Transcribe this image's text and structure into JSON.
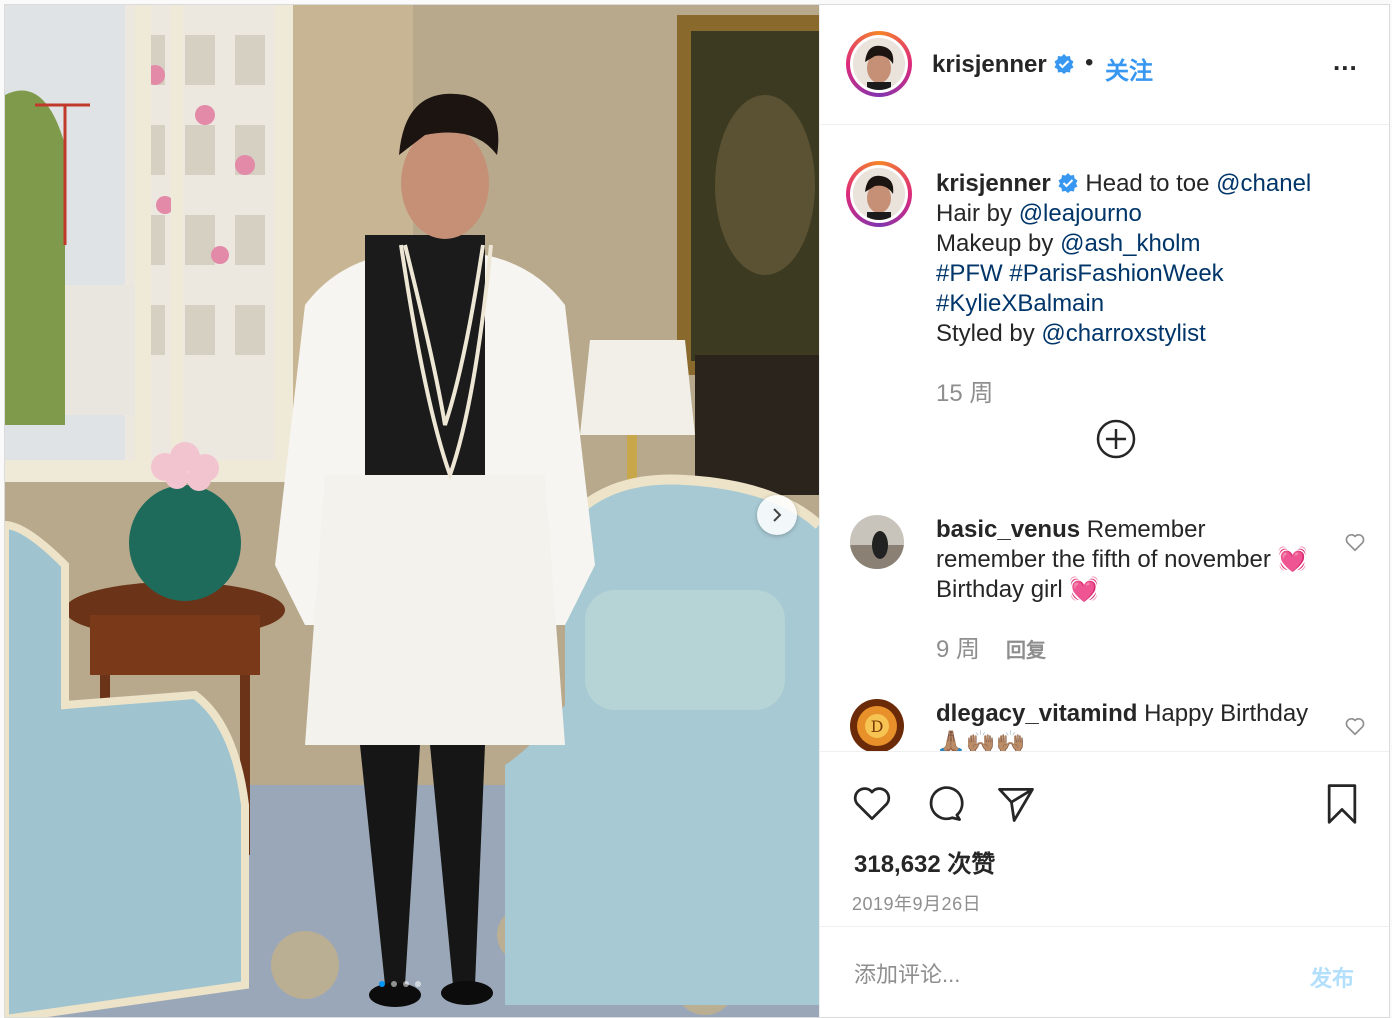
{
  "header": {
    "username": "krisjenner",
    "separator": "•",
    "follow_label": "关注",
    "more_label": "..."
  },
  "caption": {
    "username": "krisjenner",
    "lines": [
      [
        {
          "t": "Head to toe "
        },
        {
          "t": "@chanel",
          "tag": true
        }
      ],
      [
        {
          "t": "Hair by "
        },
        {
          "t": "@leajourno",
          "tag": true
        }
      ],
      [
        {
          "t": "Makeup by "
        },
        {
          "t": "@ash_kholm",
          "tag": true
        }
      ],
      [
        {
          "t": "#PFW",
          "tag": true
        },
        {
          "t": " "
        },
        {
          "t": "#ParisFashionWeek",
          "tag": true
        }
      ],
      [
        {
          "t": "#KylieXBalmain",
          "tag": true
        }
      ],
      [
        {
          "t": "Styled by "
        },
        {
          "t": "@charroxstylist",
          "tag": true
        }
      ]
    ],
    "time": "15 周"
  },
  "comments": [
    {
      "username": "basic_venus",
      "text_1": " Remember remember the fifth of november ",
      "emoji_1": "💓",
      "text_2": " Birthday girl ",
      "emoji_2": "💓",
      "time": "9 周",
      "reply_label": "回复"
    },
    {
      "username": "dlegacy_vitamind",
      "text_1": " Happy Birthday ",
      "emoji_1": "🙏🏽🙌🏽🙌🏽"
    }
  ],
  "stats": {
    "likes": "318,632 次赞",
    "date": "2019年9月26日"
  },
  "add_comment": {
    "placeholder": "添加评论...",
    "post_label": "发布"
  },
  "photo": {
    "slide_count": 4,
    "active_slide": 0
  },
  "colors": {
    "link": "#003569",
    "follow": "#3897f0",
    "verified": "#3897f0",
    "post_disabled": "#b2dffc",
    "active_dot": "#0095f6"
  }
}
